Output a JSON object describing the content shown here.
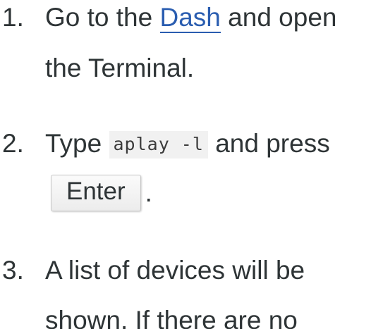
{
  "steps": [
    {
      "number": "1.",
      "line1_prefix": "Go to the ",
      "link_text": "Dash",
      "line1_suffix": " and open",
      "line2": "the Terminal."
    },
    {
      "number": "2.",
      "line1_prefix": "Type ",
      "code": "aplay -l",
      "line1_suffix": " and press",
      "key_label": "Enter",
      "line2_suffix": "."
    },
    {
      "number": "3.",
      "line1": "A list of devices will be",
      "line2": "shown. If there are no"
    }
  ]
}
